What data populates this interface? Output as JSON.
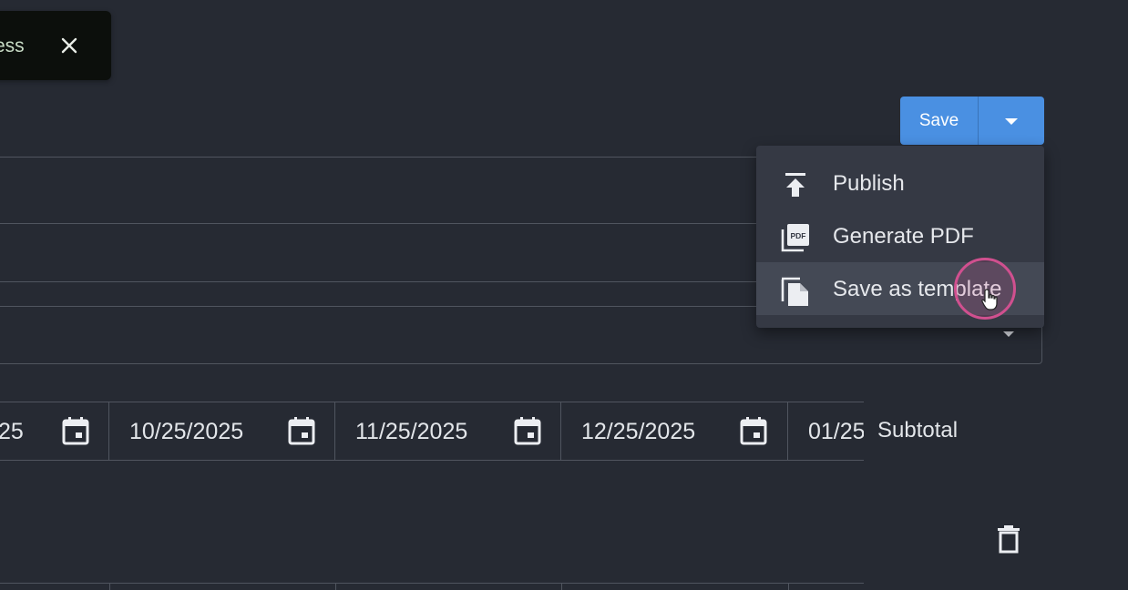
{
  "toast": {
    "text": "ess"
  },
  "save": {
    "label": "Save"
  },
  "menu": {
    "items": [
      {
        "label": "Publish",
        "icon": "publish-icon"
      },
      {
        "label": "Generate PDF",
        "icon": "pdf-icon"
      },
      {
        "label": "Save as template",
        "icon": "copy-template-icon"
      }
    ]
  },
  "dates": [
    "25",
    "10/25/2025",
    "11/25/2025",
    "12/25/2025",
    "01/25"
  ],
  "subtotal_label": "Subtotal",
  "colors": {
    "background": "#262a33",
    "accent": "#4a90e2",
    "menu": "#353944",
    "highlight": "#d0508f"
  }
}
